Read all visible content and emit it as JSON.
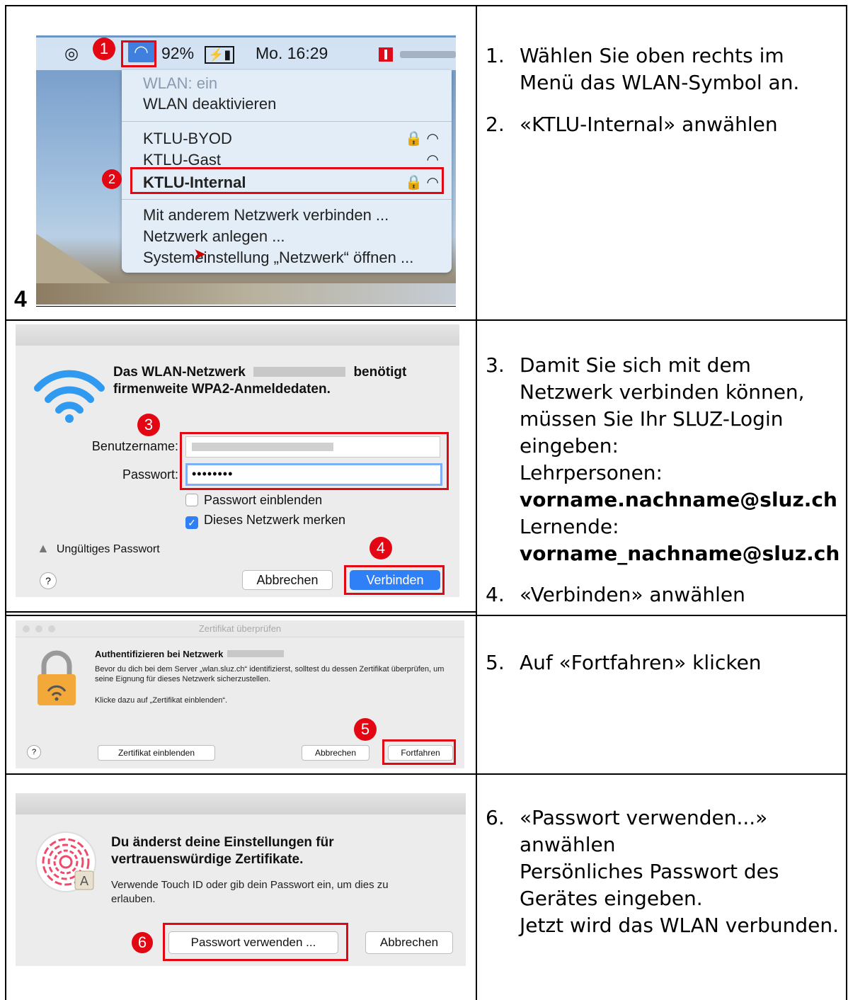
{
  "rows": [
    {
      "steps": [
        {
          "num": "1.",
          "text": "Wählen Sie oben rechts im Menü das WLAN-Symbol an."
        },
        {
          "num": "2.",
          "text": "«KTLU-Internal» anwählen"
        }
      ],
      "screenshot": {
        "corner_number": "4",
        "menubar": {
          "battery": "92%",
          "clock": "Mo. 16:29"
        },
        "menu": {
          "status": "WLAN: ein",
          "toggle": "WLAN deaktivieren",
          "networks": [
            "KTLU-BYOD",
            "KTLU-Gast",
            "KTLU-Internal"
          ],
          "actions": [
            "Mit anderem Netzwerk verbinden ...",
            "Netzwerk anlegen ...",
            "Systemeinstellung „Netzwerk“ öffnen ..."
          ]
        },
        "badges": [
          "1",
          "2"
        ]
      }
    },
    {
      "steps": [
        {
          "num": "3.",
          "text_lines": [
            "Damit Sie sich mit dem Netzwerk verbinden können, müssen Sie Ihr SLUZ-Login eingeben:"
          ],
          "teachers_label": "Lehrpersonen:",
          "teachers_login": "vorname.nachname@sluz.ch",
          "learners_label": "Lernende:",
          "learners_login": "vorname_nachname@sluz.ch"
        },
        {
          "num": "4.",
          "text": "«Verbinden» anwählen"
        }
      ],
      "screenshot": {
        "heading_before": "Das WLAN-Netzwerk",
        "heading_after": "benötigt",
        "heading_line2": "firmenweite WPA2-Anmeldedaten.",
        "username_label": "Benutzername:",
        "password_label": "Passwort:",
        "password_value": "••••••••",
        "show_password": "Passwort einblenden",
        "remember": "Dieses Netzwerk merken",
        "warning": "Ungültiges Passwort",
        "cancel": "Abbrechen",
        "connect": "Verbinden",
        "help": "?",
        "badges": [
          "3",
          "4"
        ]
      }
    },
    {
      "steps": [
        {
          "num": "5.",
          "text": "Auf «Fortfahren» klicken"
        }
      ],
      "screenshot": {
        "window_title": "Zertifikat überprüfen",
        "heading": "Authentifizieren bei Netzwerk",
        "para1": "Bevor du dich bei dem Server „wlan.sluz.ch“ identifizierst, solltest du dessen Zertifikat überprüfen, um seine Eignung für dieses Netzwerk sicherzustellen.",
        "para2": "Klicke dazu auf „Zertifikat einblenden“.",
        "show_cert": "Zertifikat einblenden",
        "cancel": "Abbrechen",
        "continue": "Fortfahren",
        "help": "?",
        "badges": [
          "5"
        ]
      }
    },
    {
      "steps": [
        {
          "num": "6.",
          "text_lines": [
            "«Passwort verwenden...» anwählen",
            "Persönliches Passwort des Gerätes eingeben.",
            "Jetzt wird das WLAN verbunden."
          ]
        }
      ],
      "screenshot": {
        "heading": "Du änderst deine Einstellungen für vertrauenswürdige Zertifikate.",
        "body": "Verwende Touch ID oder gib dein Passwort ein, um dies zu erlauben.",
        "use_password": "Passwort verwenden ...",
        "cancel": "Abbrechen",
        "badges": [
          "6"
        ]
      }
    }
  ],
  "colors": {
    "highlight": "#e30613",
    "accent": "#2f7ff6"
  }
}
